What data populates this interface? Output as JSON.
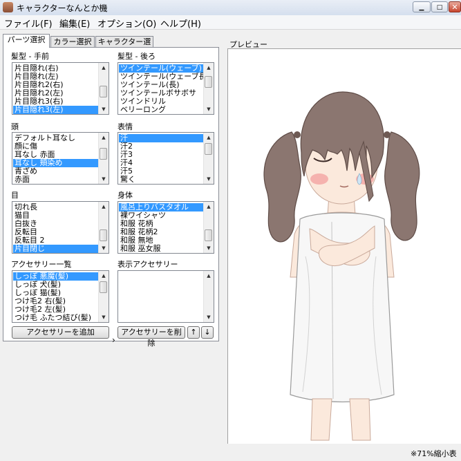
{
  "window": {
    "title": "キャラクターなんとか機",
    "minimize_glyph": "▁",
    "maximize_glyph": "□",
    "close_glyph": "✕"
  },
  "menu": [
    "ファイル(F)",
    "編集(E)",
    "オプション(O)",
    "ヘルプ(H)"
  ],
  "tabs": [
    "パーツ選択",
    "カラー選択",
    "キャラクター選択"
  ],
  "groups": {
    "hair_front": {
      "label": "髪型 - 手前",
      "items": [
        "片目隠れ(右)",
        "片目隠れ(左)",
        "片目隠れ2(右)",
        "片目隠れ2(左)",
        "片目隠れ3(右)",
        "片目隠れ3(左)"
      ],
      "selected": 5
    },
    "hair_back": {
      "label": "髪型 - 後ろ",
      "items": [
        "ツインテール(ウェーブ)",
        "ツインテール(ウェーブ長)",
        "ツインテール(長)",
        "ツインテールボサボサ",
        "ツインドリル",
        "ベリーロング"
      ],
      "selected": 0
    },
    "head": {
      "label": "頭",
      "items": [
        "デフォルト耳なし",
        "顔に傷",
        "耳なし 赤面",
        "耳なし 頬染め",
        "青ざめ",
        "赤面"
      ],
      "selected": 3
    },
    "expression": {
      "label": "表情",
      "items": [
        "汗",
        "汗2",
        "汗3",
        "汗4",
        "汗5",
        "驚く"
      ],
      "selected": 0
    },
    "eyes": {
      "label": "目",
      "items": [
        "切れ長",
        "猫目",
        "白抜き",
        "反転目",
        "反転目 2",
        "片目閉じ"
      ],
      "selected": 5
    },
    "body": {
      "label": "身体",
      "items": [
        "風呂上りバスタオル",
        "裸ワイシャツ",
        "和服 花柄",
        "和服 花柄2",
        "和服 無地",
        "和服 巫女服"
      ],
      "selected": 0
    },
    "accessories": {
      "label": "アクセサリー一覧",
      "items": [
        "しっぽ 悪魔(髪)",
        "しっぽ 犬(髪)",
        "しっぽ 猫(髪)",
        "つけ毛2 右(髪)",
        "つけ毛2 左(髪)",
        "つけ毛 ふたつ結び(髪)"
      ],
      "selected": 0
    },
    "shown_accessories": {
      "label": "表示アクセサリー",
      "items": []
    }
  },
  "buttons": {
    "add_accessory": "アクセサリーを追加",
    "remove_accessory": "アクセサリーを削除",
    "move_up": "↑",
    "move_down": "↓",
    "transfer_arrow": "›"
  },
  "preview": {
    "label": "プレビュー",
    "status": "※71%縮小表"
  },
  "colors": {
    "selection": "#3399ff",
    "hair": "#8b7670",
    "skin": "#fbe9dc",
    "towel": "#f7f7f7",
    "blush": "#f29a9a"
  }
}
